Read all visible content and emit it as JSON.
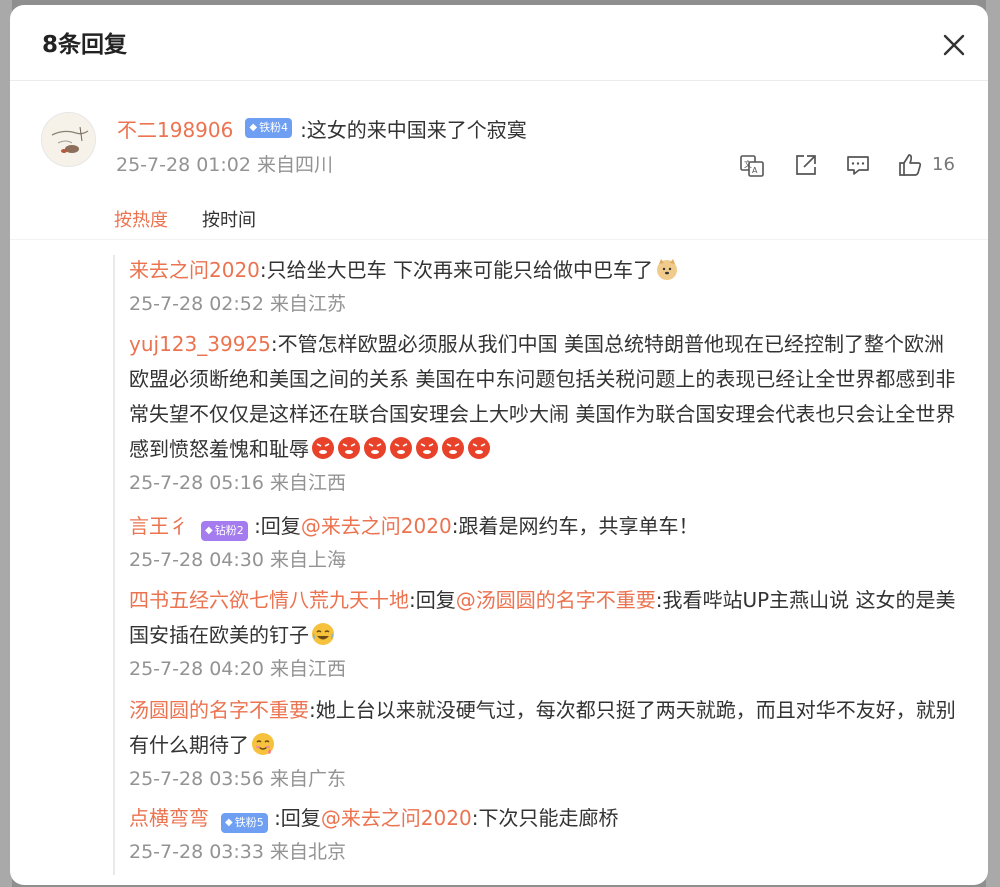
{
  "modal": {
    "title": "8条回复"
  },
  "main_comment": {
    "username": "不二198906",
    "badge": "铁粉4",
    "text": ":这女的来中国来了个寂寞",
    "meta": "25-7-28 01:02 来自四川",
    "like_count": "16"
  },
  "icons": {
    "translate": "translate-icon",
    "share": "share-icon",
    "comment": "comment-icon",
    "like": "thumbs-up-icon",
    "close": "close-icon"
  },
  "tabs": [
    {
      "label": "按热度"
    },
    {
      "label": "按时间"
    }
  ],
  "colors": {
    "accent": "#eb7350",
    "meta_gray": "#939393",
    "text": "#333333",
    "badge_blue": "#6f9ff2",
    "badge_purple": "#a47cf0"
  },
  "replies": [
    {
      "username": "来去之问2020",
      "text": ":只给坐大巴车  下次再来可能只给做中巴车了",
      "emoji": "doge",
      "meta": "25-7-28 02:52 来自江苏"
    },
    {
      "username": "yuj123_39925",
      "text": ":不管怎样欧盟必须服从我们中国 美国总统特朗普他现在已经控制了整个欧洲 欧盟必须断绝和美国之间的关系 美国在中东问题包括关税问题上的表现已经让全世界都感到非常失望不仅仅是这样还在联合国安理会上大吵大闹 美国作为联合国安理会代表也只会让全世界感到愤怒羞愧和耻辱",
      "emoji": "angry x7",
      "meta": "25-7-28 05:16 来自江西"
    },
    {
      "username": "言王彳",
      "badge": "钻粉2",
      "reply_prefix": ":回复",
      "mention": "@来去之问2020",
      "text": ":跟着是网约车，共享单车！",
      "meta": "25-7-28 04:30 来自上海"
    },
    {
      "username": "四书五经六欲七情八荒九天十地",
      "reply_prefix": ":回复",
      "mention": "@汤圆圆的名字不重要",
      "text": ":我看哔站UP主燕山说 这女的是美国安插在欧美的钉子",
      "emoji": "laugh-cry",
      "meta": "25-7-28 04:20 来自江西"
    },
    {
      "username": "汤圆圆的名字不重要",
      "text": ":她上台以来就没硬气过，每次都只挺了两天就跪，而且对华不友好，就别有什么期待了",
      "emoji": "drool",
      "meta": "25-7-28 03:56 来自广东"
    },
    {
      "username": "点横弯弯",
      "badge": "铁粉5",
      "reply_prefix": ":回复",
      "mention": "@来去之问2020",
      "text": ":下次只能走廊桥",
      "meta": "25-7-28 03:33 来自北京"
    }
  ]
}
